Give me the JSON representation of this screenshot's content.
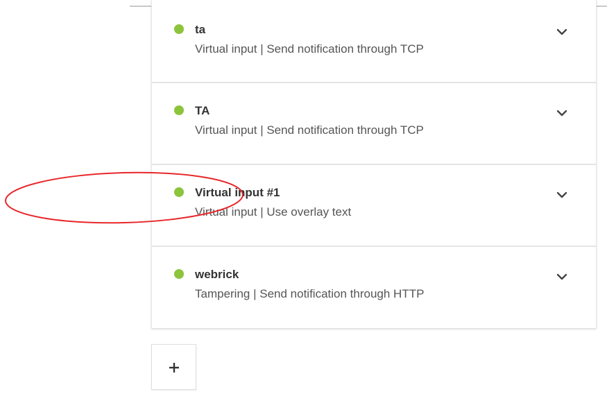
{
  "rules": [
    {
      "name": "ta",
      "description": "Virtual input | Send notification through TCP",
      "status_color": "#8cc43c"
    },
    {
      "name": "TA",
      "description": "Virtual input | Send notification through TCP",
      "status_color": "#8cc43c"
    },
    {
      "name": "Virtual input #1",
      "description": "Virtual input | Use overlay text",
      "status_color": "#8cc43c"
    },
    {
      "name": "webrick",
      "description": "Tampering | Send notification through HTTP",
      "status_color": "#8cc43c"
    }
  ],
  "icons": {
    "expand": "chevron-down-icon",
    "add": "plus-icon"
  },
  "annotation_color": "#e8262a"
}
